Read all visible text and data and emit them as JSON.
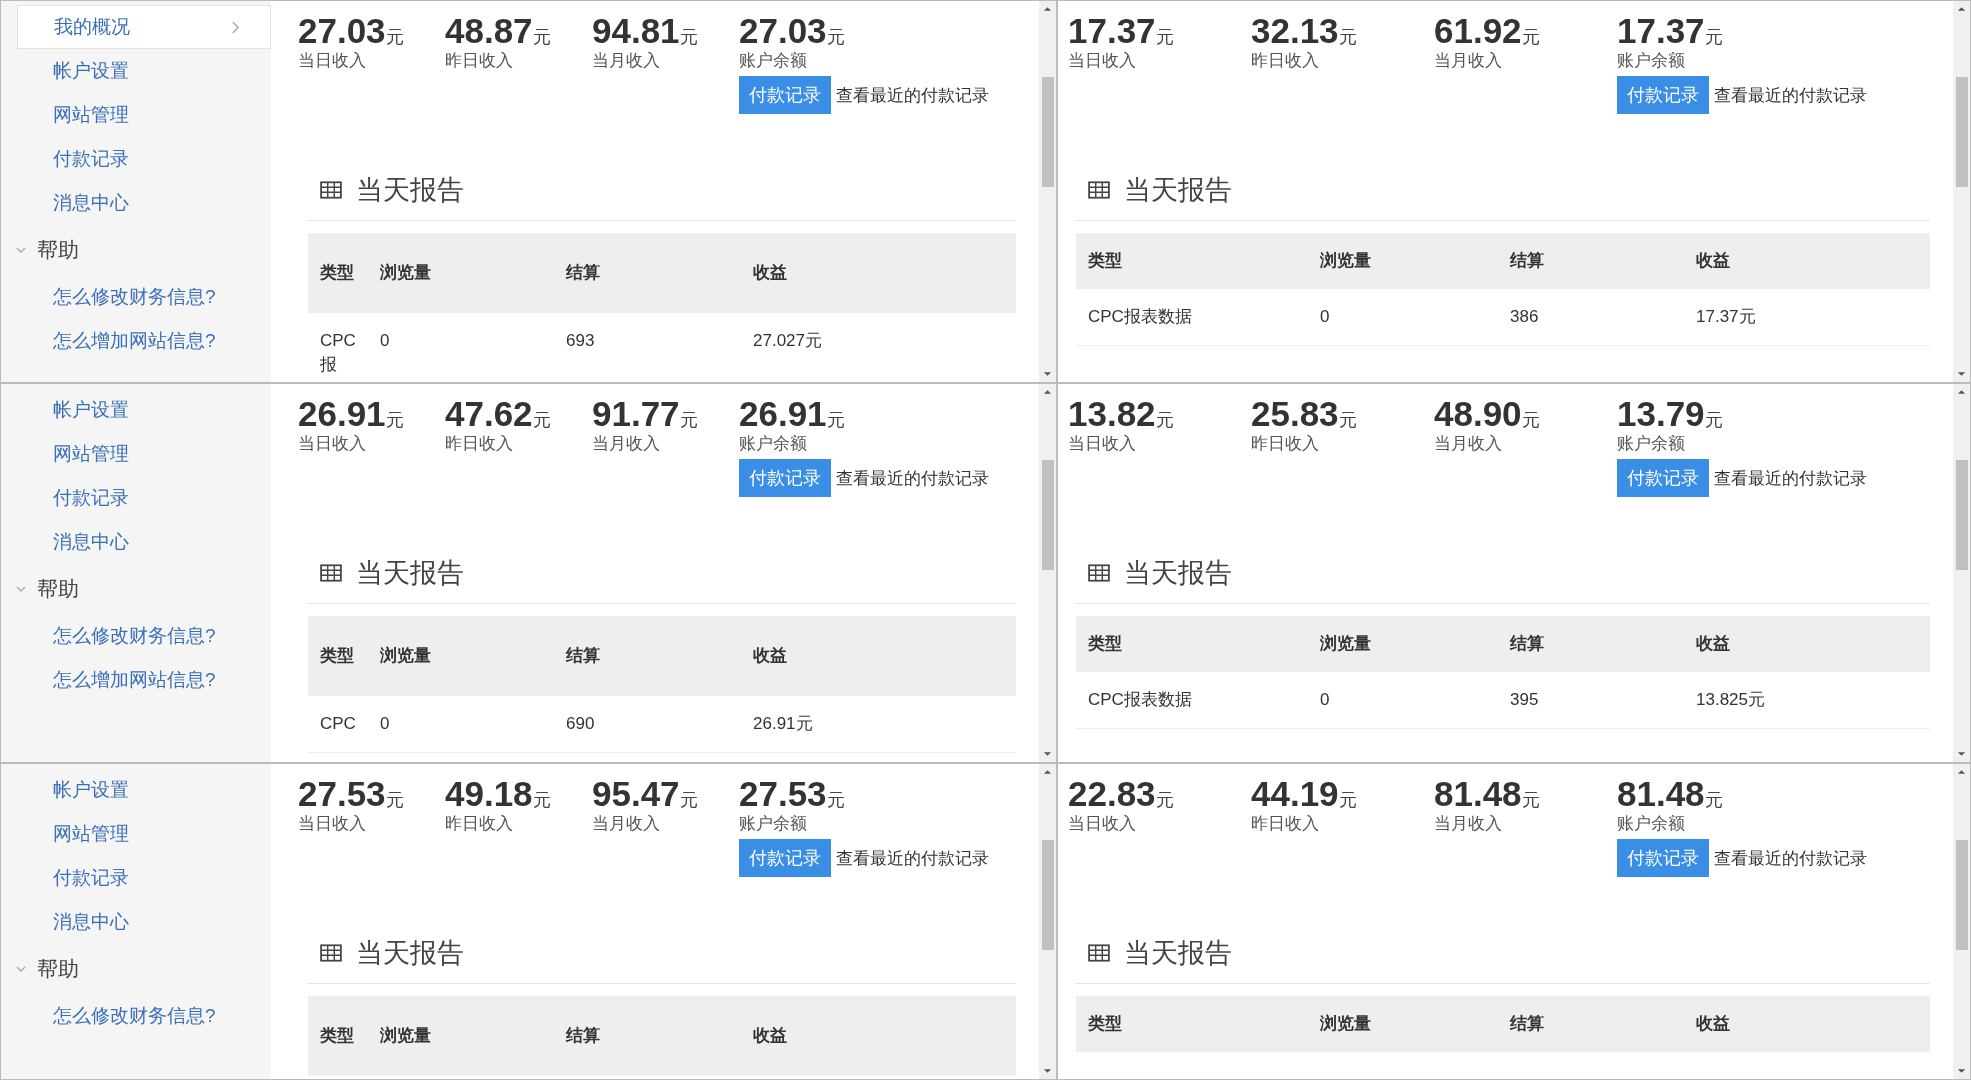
{
  "panels": [
    {
      "kind": "with_sidebar",
      "sidebar": {
        "items": [
          {
            "label": "我的概况",
            "selected": true
          },
          {
            "label": "帐户设置",
            "selected": false
          },
          {
            "label": "网站管理",
            "selected": false
          },
          {
            "label": "付款记录",
            "selected": false
          },
          {
            "label": "消息中心",
            "selected": false
          }
        ],
        "help": {
          "title": "帮助",
          "expanded": true,
          "items": [
            "怎么修改财务信息?",
            "怎么增加网站信息?"
          ]
        }
      },
      "stats": [
        {
          "value": "27.03",
          "unit": "元",
          "label": "当日收入"
        },
        {
          "value": "48.87",
          "unit": "元",
          "label": "昨日收入"
        },
        {
          "value": "94.81",
          "unit": "元",
          "label": "当月收入"
        },
        {
          "value": "27.03",
          "unit": "元",
          "label": "账户余额"
        }
      ],
      "pay_button": "付款记录",
      "pay_link": "查看最近的付款记录",
      "report": {
        "title": "当天报告",
        "columns": [
          "类型",
          "浏览量",
          "结算",
          "收益"
        ],
        "rows": [
          [
            "CPC报",
            "0",
            "693",
            "27.027元"
          ]
        ]
      }
    },
    {
      "kind": "content_only",
      "stats": [
        {
          "value": "17.37",
          "unit": "元",
          "label": "当日收入"
        },
        {
          "value": "32.13",
          "unit": "元",
          "label": "昨日收入"
        },
        {
          "value": "61.92",
          "unit": "元",
          "label": "当月收入"
        },
        {
          "value": "17.37",
          "unit": "元",
          "label": "账户余额"
        }
      ],
      "pay_button": "付款记录",
      "pay_link": "查看最近的付款记录",
      "report": {
        "title": "当天报告",
        "columns": [
          "类型",
          "浏览量",
          "结算",
          "收益"
        ],
        "rows": [
          [
            "CPC报表数据",
            "0",
            "386",
            "17.37元"
          ]
        ]
      }
    },
    {
      "kind": "with_sidebar",
      "sidebar": {
        "items": [
          {
            "label": "帐户设置",
            "selected": false
          },
          {
            "label": "网站管理",
            "selected": false
          },
          {
            "label": "付款记录",
            "selected": false
          },
          {
            "label": "消息中心",
            "selected": false
          }
        ],
        "help": {
          "title": "帮助",
          "expanded": true,
          "items": [
            "怎么修改财务信息?",
            "怎么增加网站信息?"
          ]
        }
      },
      "stats": [
        {
          "value": "26.91",
          "unit": "元",
          "label": "当日收入"
        },
        {
          "value": "47.62",
          "unit": "元",
          "label": "昨日收入"
        },
        {
          "value": "91.77",
          "unit": "元",
          "label": "当月收入"
        },
        {
          "value": "26.91",
          "unit": "元",
          "label": "账户余额"
        }
      ],
      "pay_button": "付款记录",
      "pay_link": "查看最近的付款记录",
      "report": {
        "title": "当天报告",
        "columns": [
          "类型",
          "浏览量",
          "结算",
          "收益"
        ],
        "rows": [
          [
            "CPC",
            "0",
            "690",
            "26.91元"
          ]
        ]
      }
    },
    {
      "kind": "content_only",
      "stats": [
        {
          "value": "13.82",
          "unit": "元",
          "label": "当日收入"
        },
        {
          "value": "25.83",
          "unit": "元",
          "label": "昨日收入"
        },
        {
          "value": "48.90",
          "unit": "元",
          "label": "当月收入"
        },
        {
          "value": "13.79",
          "unit": "元",
          "label": "账户余额"
        }
      ],
      "pay_button": "付款记录",
      "pay_link": "查看最近的付款记录",
      "report": {
        "title": "当天报告",
        "columns": [
          "类型",
          "浏览量",
          "结算",
          "收益"
        ],
        "rows": [
          [
            "CPC报表数据",
            "0",
            "395",
            "13.825元"
          ]
        ]
      }
    },
    {
      "kind": "with_sidebar",
      "sidebar": {
        "items": [
          {
            "label": "帐户设置",
            "selected": false
          },
          {
            "label": "网站管理",
            "selected": false
          },
          {
            "label": "付款记录",
            "selected": false
          },
          {
            "label": "消息中心",
            "selected": false
          }
        ],
        "help": {
          "title": "帮助",
          "expanded": true,
          "items": [
            "怎么修改财务信息?"
          ]
        }
      },
      "stats": [
        {
          "value": "27.53",
          "unit": "元",
          "label": "当日收入"
        },
        {
          "value": "49.18",
          "unit": "元",
          "label": "昨日收入"
        },
        {
          "value": "95.47",
          "unit": "元",
          "label": "当月收入"
        },
        {
          "value": "27.53",
          "unit": "元",
          "label": "账户余额"
        }
      ],
      "pay_button": "付款记录",
      "pay_link": "查看最近的付款记录",
      "report": {
        "title": "当天报告",
        "columns": [
          "类型",
          "浏览量",
          "结算",
          "收益"
        ]
      }
    },
    {
      "kind": "content_only",
      "stats": [
        {
          "value": "22.83",
          "unit": "元",
          "label": "当日收入"
        },
        {
          "value": "44.19",
          "unit": "元",
          "label": "昨日收入"
        },
        {
          "value": "81.48",
          "unit": "元",
          "label": "当月收入"
        },
        {
          "value": "81.48",
          "unit": "元",
          "label": "账户余额"
        }
      ],
      "pay_button": "付款记录",
      "pay_link": "查看最近的付款记录",
      "report": {
        "title": "当天报告",
        "columns": [
          "类型",
          "浏览量",
          "结算",
          "收益"
        ]
      }
    }
  ]
}
